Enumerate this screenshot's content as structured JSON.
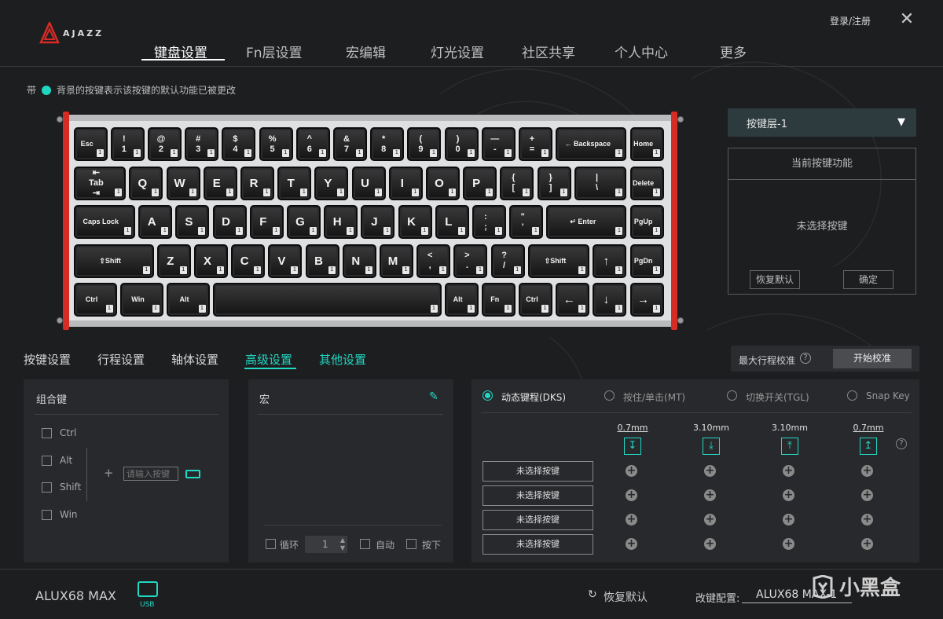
{
  "header": {
    "brand": "AJAZZ",
    "login": "登录/注册",
    "tabs": [
      "键盘设置",
      "Fn层设置",
      "宏编辑",
      "灯光设置",
      "社区共享",
      "个人中心",
      "更多"
    ]
  },
  "notice": {
    "prefix": "带",
    "text": "背景的按键表示该按键的默认功能已被更改"
  },
  "keyboard": {
    "rows": [
      [
        "Esc",
        "!\n1",
        "@\n2",
        "#\n3",
        "$\n4",
        "%\n5",
        "^\n6",
        "&\n7",
        "*\n8",
        "(\n9",
        ")\n0",
        "—\n-",
        "+\n=",
        "← Backspace",
        "Home"
      ],
      [
        "⇤\nTab\n⇥",
        "Q",
        "W",
        "E",
        "R",
        "T",
        "Y",
        "U",
        "I",
        "O",
        "P",
        "{\n[",
        "}\n]",
        "|\n\\",
        "Delete"
      ],
      [
        "Caps Lock",
        "A",
        "S",
        "D",
        "F",
        "G",
        "H",
        "J",
        "K",
        "L",
        ":\n;",
        "\"\n'",
        "↵ Enter",
        "PgUp"
      ],
      [
        "⇧Shift",
        "Z",
        "X",
        "C",
        "V",
        "B",
        "N",
        "M",
        "<\n,",
        ">\n.",
        "?\n/",
        "⇧Shift",
        "↑",
        "PgDn"
      ],
      [
        "Ctrl",
        "Win",
        "Alt",
        "",
        "Alt",
        "Fn",
        "Ctrl",
        "←",
        "↓",
        "→"
      ]
    ],
    "badge": "1"
  },
  "right_panel": {
    "layer": "按键层-1",
    "function_title": "当前按键功能",
    "function_status": "未选择按键",
    "restore": "恢复默认",
    "confirm": "确定"
  },
  "subtabs": [
    "按键设置",
    "行程设置",
    "轴体设置",
    "高级设置",
    "其他设置"
  ],
  "calibration": {
    "label": "最大行程校准",
    "help": "?",
    "button": "开始校准"
  },
  "combo": {
    "title": "组合键",
    "modifiers": [
      "Ctrl",
      "Alt",
      "Shift",
      "Win"
    ],
    "plus": "+",
    "placeholder": "请输入按键"
  },
  "macro": {
    "title": "宏",
    "loop_label": "循环",
    "loop_value": "1",
    "auto_label": "自动",
    "press_label": "按下"
  },
  "dks": {
    "modes": [
      "动态键程(DKS)",
      "按住/单击(MT)",
      "切换开关(TGL)",
      "Snap Key"
    ],
    "selected_mode": 0,
    "points": [
      {
        "value": "0.7mm",
        "arrow": "↧"
      },
      {
        "value": "3.10mm",
        "arrow": "⤓"
      },
      {
        "value": "3.10mm",
        "arrow": "⤒"
      },
      {
        "value": "0.7mm",
        "arrow": "↥"
      }
    ],
    "help": "?",
    "key_buttons": [
      "未选择按键",
      "未选择按键",
      "未选择按键",
      "未选择按键"
    ]
  },
  "footer": {
    "model": "ALUX68 MAX",
    "connection": "USB",
    "restore": "恢复默认",
    "config_label": "改键配置:",
    "config_value": "ALUX68 MAX-1",
    "watermark": "小黑盒"
  },
  "colors": {
    "accent": "#21d9c4",
    "rail": "#d72b25",
    "background": "#1d1e20"
  }
}
